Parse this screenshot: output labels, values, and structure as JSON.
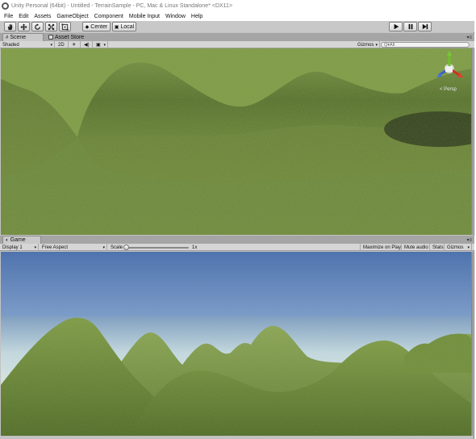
{
  "window": {
    "title": "Unity Personal (64bit) - Untitled - TerrainSample - PC, Mac & Linux Standalone* <DX11>"
  },
  "menu": [
    "File",
    "Edit",
    "Assets",
    "GameObject",
    "Component",
    "Mobile Input",
    "Window",
    "Help"
  ],
  "toolbar": {
    "pivot_label": "Center",
    "space_label": "Local"
  },
  "scene": {
    "tabs": [
      {
        "label": "Scene",
        "active": true
      },
      {
        "label": "Asset Store",
        "active": false
      }
    ],
    "shading_mode": "Shaded",
    "mode_2d": "2D",
    "gizmos_label": "Gizmos",
    "search_placeholder": "Q▾All",
    "camera_label": "< Persp"
  },
  "game": {
    "tab_label": "Game",
    "display": "Display 1",
    "aspect": "Free Aspect",
    "scale_label": "Scale",
    "scale_value": "1x",
    "scale_fraction": 0.0,
    "maximize_label": "Maximize on Play",
    "mute_label": "Mute audio",
    "stats_label": "Stats",
    "gizmos_label": "Gizmos"
  },
  "colors": {
    "grass_dark": "#4f6a27",
    "grass_light": "#7c9642",
    "sky_top": "#5a7bb0",
    "sky_horizon": "#cfe0ea",
    "editor_bg": "#c2c2c2"
  }
}
